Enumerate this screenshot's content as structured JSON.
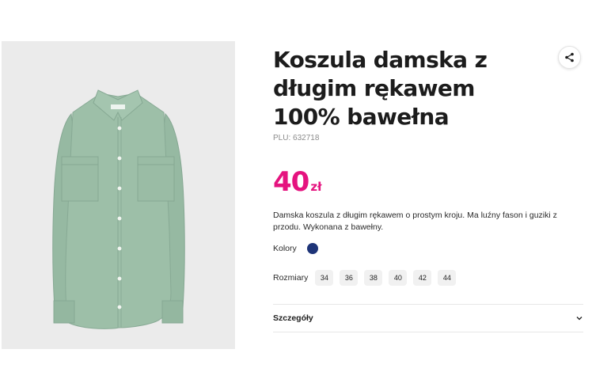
{
  "product": {
    "title": "Koszula damska z długim rękawem 100% bawełna",
    "plu": "PLU: 632718",
    "price_amount": "40",
    "price_currency": "zł",
    "price_color": "#e5137f",
    "description": "Damska koszula z długim rękawem o prostym kroju. Ma luźny fason i guziki z przodu. Wykonana z bawełny.",
    "image": {
      "icon": "shirt-photo",
      "shirt_color": "#9dbfa8",
      "background": "#ebebeb"
    }
  },
  "share": {
    "icon": "share-icon"
  },
  "colors": {
    "label": "Kolory",
    "options": [
      {
        "color": "#1e3478"
      }
    ]
  },
  "sizes": {
    "label": "Rozmiary",
    "options": [
      "34",
      "36",
      "38",
      "40",
      "42",
      "44"
    ]
  },
  "details": {
    "label": "Szczegóły",
    "icon": "chevron-down-icon"
  }
}
